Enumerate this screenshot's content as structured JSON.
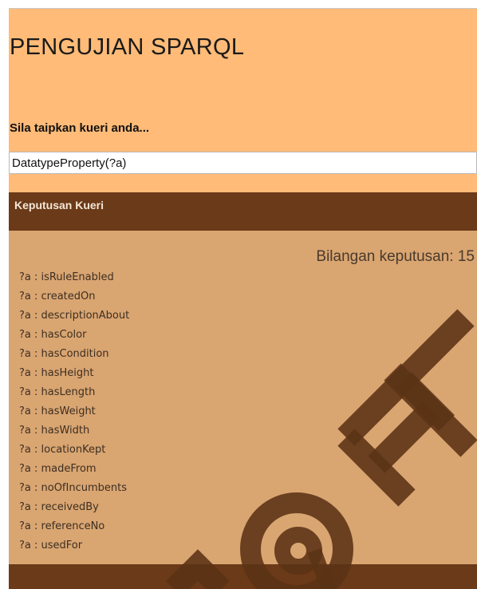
{
  "header": {
    "title": "PENGUJIAN SPARQL",
    "query_label": "Sila taipkan kueri anda..."
  },
  "query": {
    "value": "DatatypeProperty(?a)"
  },
  "results": {
    "section_title": "Keputusan Kueri",
    "count_text": "Bilangan keputusan: 15",
    "items": [
      "?a : isRuleEnabled",
      "?a : createdOn",
      "?a : descriptionAbout",
      "?a : hasColor",
      "?a : hasCondition",
      "?a : hasHeight",
      "?a : hasLength",
      "?a : hasWeight",
      "?a : hasWidth",
      "?a : locationKept",
      "?a : madeFrom",
      "?a : noOfIncumbents",
      "?a : receivedBy",
      "?a : referenceNo",
      "?a : usedFor"
    ]
  },
  "watermark": {
    "text": "@FT",
    "color": "#5a3214"
  },
  "colors": {
    "top_panel": "#ffbb77",
    "section_header": "#6b3a18",
    "results_bg": "#d9a571"
  }
}
